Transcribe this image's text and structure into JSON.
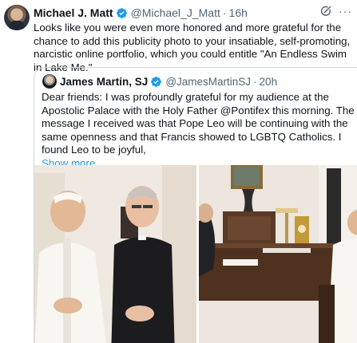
{
  "tweet": {
    "author_name": "Michael J. Matt",
    "author_handle": "@Michael_J_Matt",
    "separator": "·",
    "time": "16h",
    "text": "Looks like you were even more honored and more grateful for the chance to add this publicity photo to your insatiable, self-promoting, narcistic online portfolio, which you could entitle \"An Endless Swim in Lake Me.\"",
    "more_icon": "···"
  },
  "quoted_tweet": {
    "author_name": "James Martin, SJ",
    "author_handle": "@JamesMartinSJ",
    "separator": "·",
    "time": "20h",
    "text": "Dear friends: I was profoundly grateful for my audience at the Apostolic Palace with the Holy Father @Pontifex  this morning. The message I received was that Pope Leo will be continuing with the same openness and that Francis showed to LGBTQ Catholics. I found Leo to be joyful,",
    "show_more": "Show more"
  },
  "icons": {
    "verified": "verified-badge-icon",
    "grok": "grok-icon",
    "more": "more-icon"
  },
  "colors": {
    "text_primary": "#0f1419",
    "text_secondary": "#536471",
    "link": "#1d9bf0",
    "verified_blue": "#1d9bf0",
    "border": "#cfd9de"
  }
}
